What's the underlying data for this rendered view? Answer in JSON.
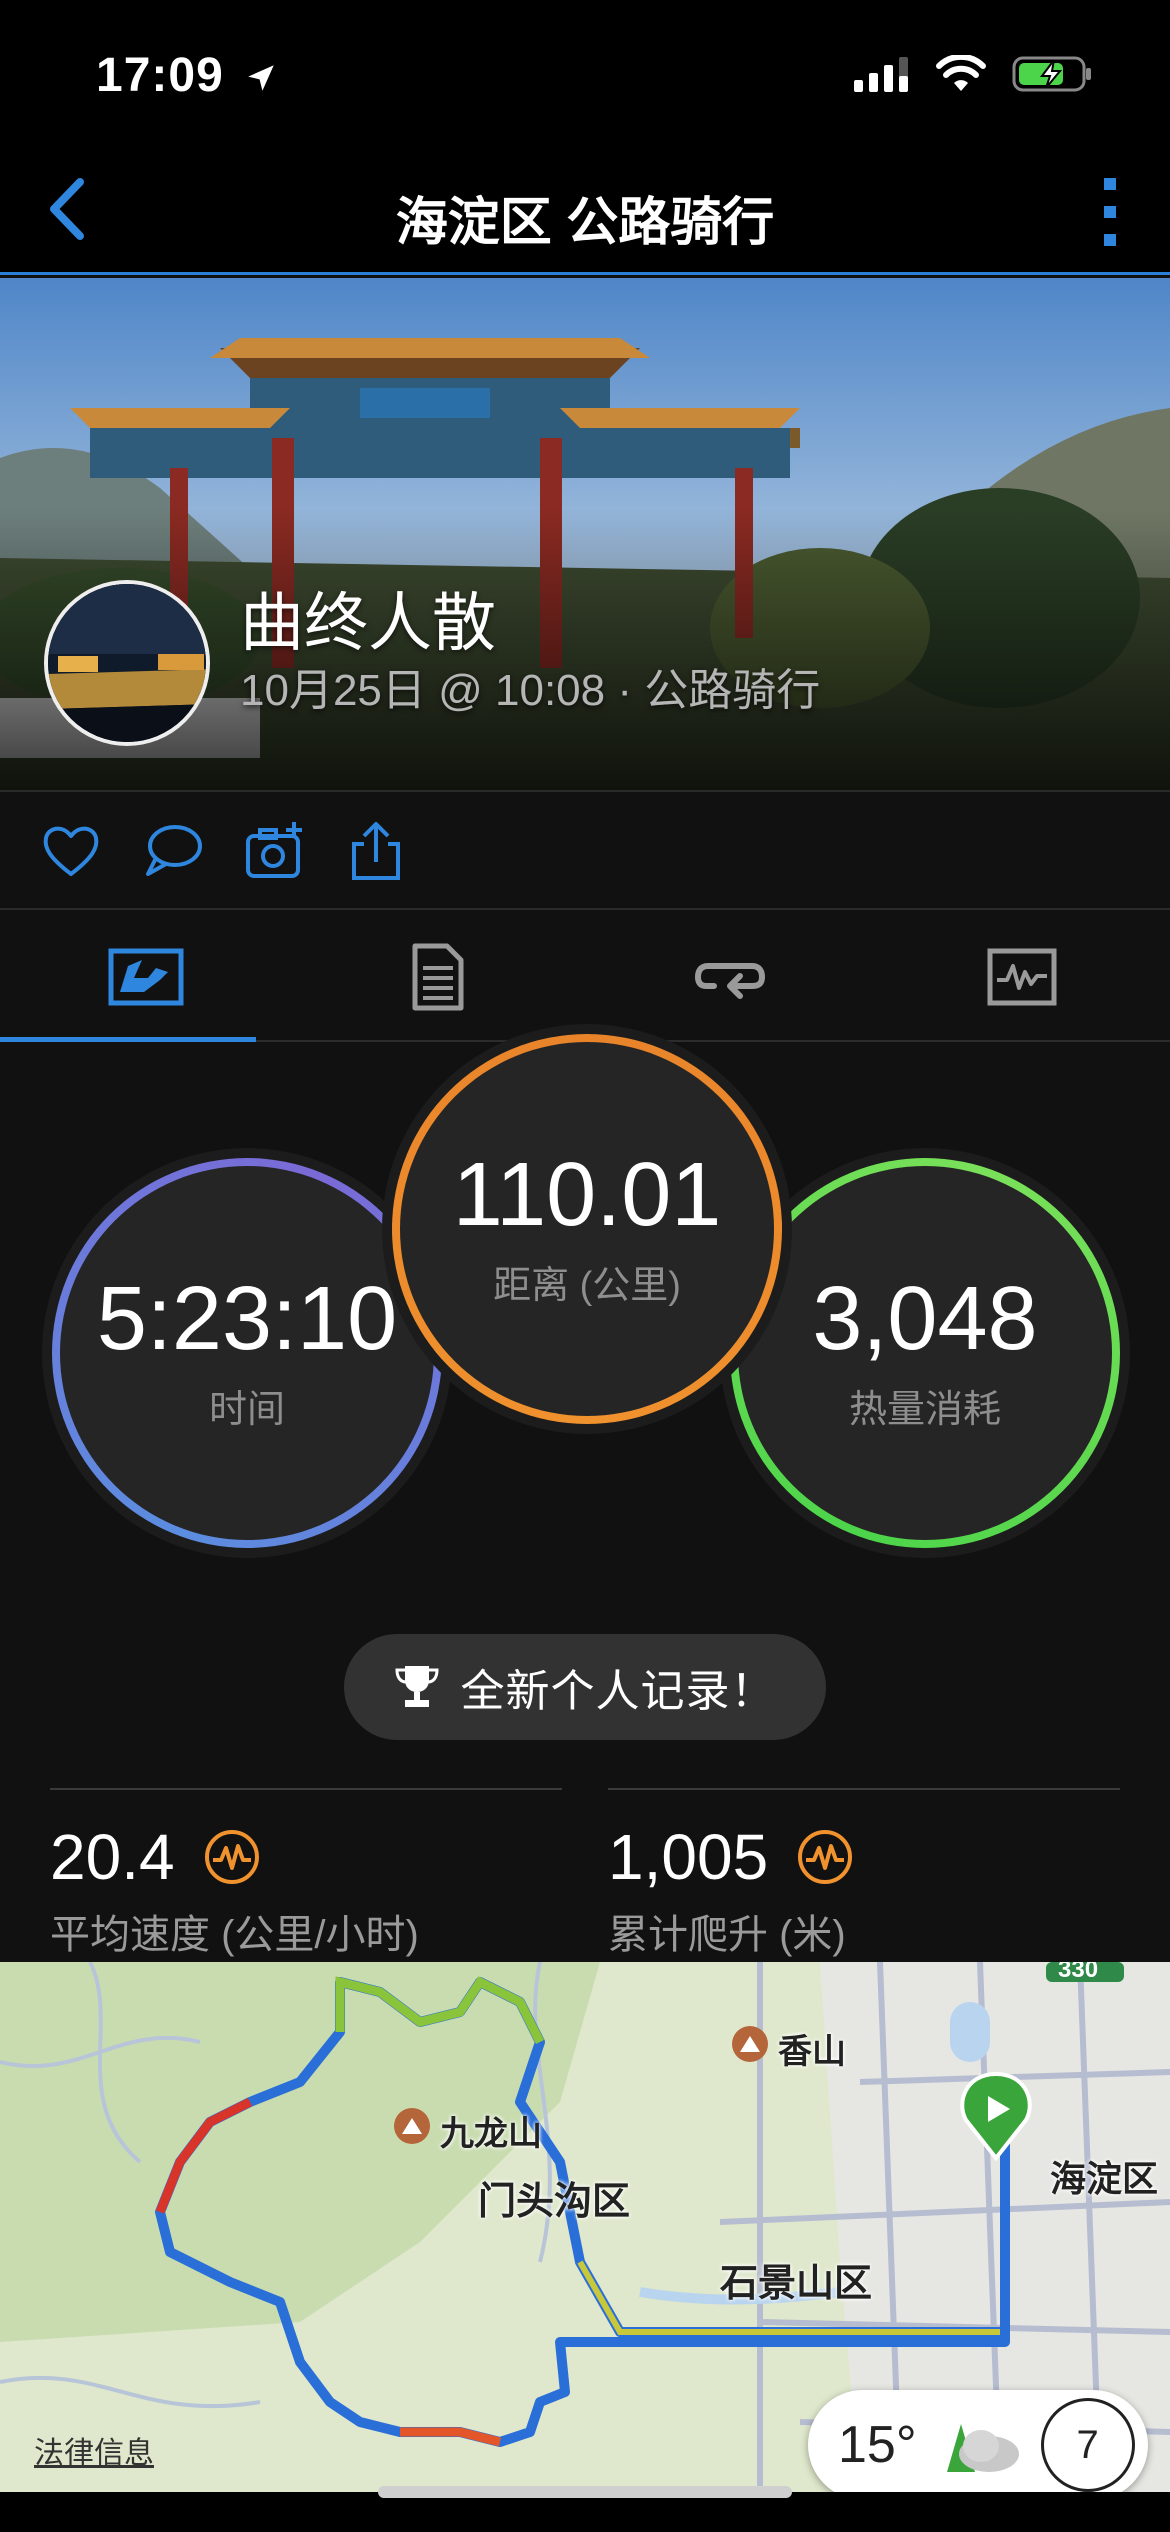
{
  "status_bar": {
    "time": "17:09"
  },
  "nav": {
    "title": "海淀区 公路骑行"
  },
  "activity": {
    "name": "曲终人散",
    "meta": "10月25日 @ 10:08 · 公路骑行"
  },
  "tabs": [
    {
      "icon": "overview-icon",
      "active": true
    },
    {
      "icon": "details-icon",
      "active": false
    },
    {
      "icon": "laps-icon",
      "active": false
    },
    {
      "icon": "charts-icon",
      "active": false
    }
  ],
  "stats": {
    "time": {
      "value": "5:23:10",
      "label": "时间"
    },
    "distance": {
      "value": "110.01",
      "label": "距离 (公里)"
    },
    "calories": {
      "value": "3,048",
      "label": "热量消耗"
    }
  },
  "record": {
    "label": "全新个人记录！"
  },
  "metrics": {
    "avg_speed": {
      "value": "20.4",
      "label": "平均速度 (公里/小时)"
    },
    "elevation": {
      "value": "1,005",
      "label": "累计爬升 (米)"
    }
  },
  "map": {
    "labels": {
      "xiangshan": "香山",
      "jiulongshan": "九龙山",
      "mentougou": "门头沟区",
      "shijingshan": "石景山区",
      "haidian": "海淀区"
    },
    "road_badge": "330",
    "legal": "法律信息"
  },
  "weather": {
    "temperature": "15°",
    "badge": "7"
  },
  "colors": {
    "accent_blue": "#2e86de",
    "time_ring": "#5b8de0",
    "distance_ring": "#f0922e",
    "calories_ring": "#4cd44a",
    "pr_orange": "#f0922e"
  }
}
